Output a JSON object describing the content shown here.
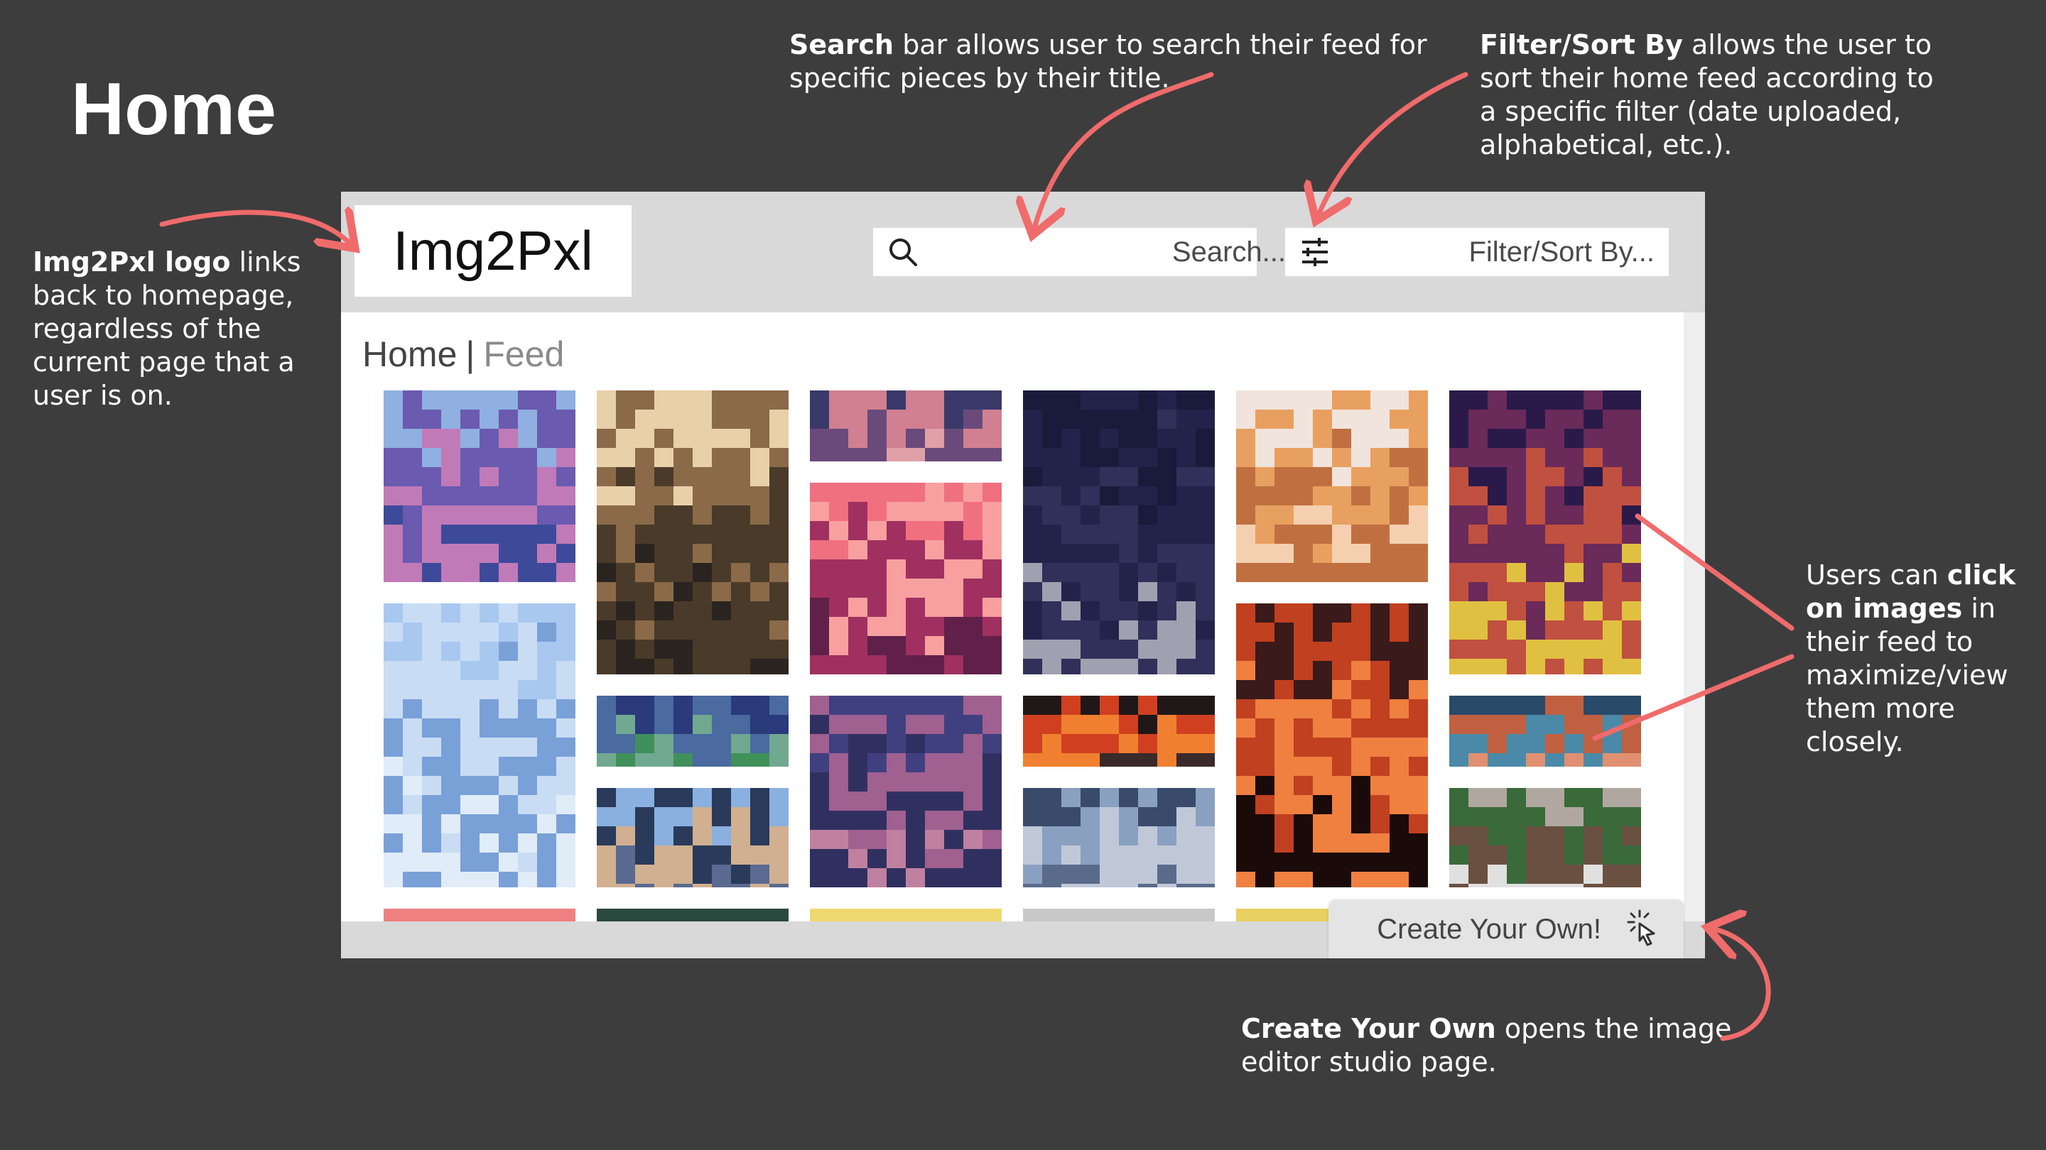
{
  "page": {
    "title": "Home"
  },
  "annotations": {
    "logo": {
      "bold": "Img2Pxl logo",
      "rest": " links back to homepage, regardless of the current page that a user is on."
    },
    "search": {
      "bold": "Search",
      "rest": " bar allows user to search their feed for specific pieces by their title."
    },
    "filter": {
      "bold": "Filter/Sort By",
      "rest": " allows the user to sort their home feed according to a specific filter (date uploaded, alphabetical, etc.)."
    },
    "click": {
      "pre": "Users can ",
      "bold": "click on images",
      "rest": " in their feed to maximize/view them more closely."
    },
    "create": {
      "bold": "Create Your Own",
      "rest": " opens the image editor studio page."
    }
  },
  "app": {
    "logo_text": "Img2Pxl",
    "search": {
      "placeholder": "Search...",
      "icon": "search-icon"
    },
    "filter": {
      "label": "Filter/Sort By...",
      "icon": "sliders-icon"
    },
    "breadcrumb": {
      "home": "Home",
      "separator": "|",
      "current": "Feed"
    },
    "create_button": {
      "label": "Create Your Own!",
      "icon": "click-cursor-icon"
    }
  },
  "colors": {
    "background": "#3d3d3d",
    "accent_arrow": "#f06b6b",
    "header": "#d9d9d9"
  },
  "feed": [
    {
      "name": "forest-lake-pixel-art",
      "colors": [
        "#8fb0e0",
        "#6a5ab0",
        "#c07ab8",
        "#3d4a9a"
      ]
    },
    {
      "name": "foggy-forest-pixel-art",
      "colors": [
        "#e8d0a8",
        "#8a6a48",
        "#4a3a2a",
        "#2a2420"
      ]
    },
    {
      "name": "sunset-clouds-pixel-art",
      "colors": [
        "#3a3a6a",
        "#d08090",
        "#6a4a7a",
        "#e0a0a8"
      ]
    },
    {
      "name": "night-moon-pixel-art",
      "colors": [
        "#1a1a3a",
        "#22224a",
        "#30305a",
        "#a0a0b0"
      ]
    },
    {
      "name": "orange-cat-pixel-art",
      "colors": [
        "#f0e4dc",
        "#e8a060",
        "#c07040",
        "#f4d0b0"
      ]
    },
    {
      "name": "haunted-house-pixel-art",
      "colors": [
        "#2a1a4a",
        "#6a2a5a",
        "#c05040",
        "#e0c040"
      ]
    },
    {
      "name": "misty-mountains-pixel-art",
      "colors": [
        "#a8c8f0",
        "#c8dcf4",
        "#7aa0d8",
        "#e0ecf8"
      ]
    },
    {
      "name": "pink-sunset-pixel-art",
      "colors": [
        "#f07080",
        "#f8a0a0",
        "#a03060",
        "#60204a"
      ]
    },
    {
      "name": "volcano-pixel-art",
      "colors": [
        "#3a1a1a",
        "#c04020",
        "#f08040",
        "#1a0a0a"
      ]
    },
    {
      "name": "starry-mountains-pixel-art",
      "colors": [
        "#2a3a7a",
        "#4a6aa0",
        "#70a890",
        "#40905a"
      ]
    },
    {
      "name": "purple-skyline-pixel-art",
      "colors": [
        "#404080",
        "#a06090",
        "#303060",
        "#c080a0"
      ]
    },
    {
      "name": "red-tree-pixel-art",
      "colors": [
        "#201818",
        "#d04020",
        "#f08030",
        "#3a2a2a"
      ]
    },
    {
      "name": "planet-orb-pixel-art",
      "colors": [
        "#2a4a6a",
        "#c06040",
        "#4a8aa8",
        "#e09070"
      ]
    },
    {
      "name": "snowy-peak-pixel-art",
      "colors": [
        "#8ab0e0",
        "#2a3a5a",
        "#d0b090",
        "#5a6a90"
      ]
    },
    {
      "name": "rocky-cliff-pixel-art",
      "colors": [
        "#3a4a6a",
        "#8aa0c0",
        "#c0c8d8",
        "#5a6a8a"
      ]
    },
    {
      "name": "mallard-duck-pixel-art",
      "colors": [
        "#b0a8a0",
        "#3a6a3a",
        "#6a5040",
        "#e0e0e0"
      ]
    },
    {
      "name": "partial-coral",
      "colors": [
        "#f08080"
      ]
    },
    {
      "name": "partial-green",
      "colors": [
        "#2a4a40"
      ]
    },
    {
      "name": "partial-yellow",
      "colors": [
        "#f0d870"
      ]
    },
    {
      "name": "partial-gray",
      "colors": [
        "#c8c8c8"
      ]
    },
    {
      "name": "partial-gold",
      "colors": [
        "#e8d060"
      ]
    }
  ]
}
